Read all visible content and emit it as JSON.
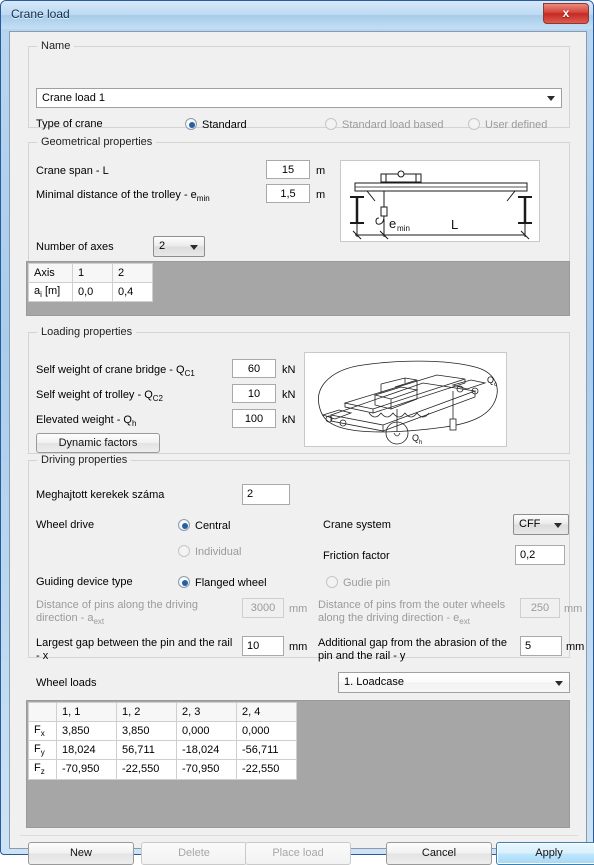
{
  "window": {
    "title": "Crane load",
    "close_label": "x"
  },
  "name_group": {
    "legend": "Name",
    "value": "Crane load 1",
    "type_label": "Type of crane",
    "options": [
      {
        "label": "Standard",
        "checked": true
      },
      {
        "label": "Standard load based",
        "checked": false
      },
      {
        "label": "User defined",
        "checked": false
      }
    ]
  },
  "geometry": {
    "legend": "Geometrical properties",
    "span_label": "Crane span - L",
    "span_value": "15",
    "span_unit": "m",
    "trolley_label": "Minimal distance of the trolley - e",
    "trolley_label_sub": "min",
    "trolley_value": "1,5",
    "trolley_unit": "m",
    "axes_label": "Number of axes",
    "axes_value": "2",
    "diagram_labels": {
      "e": "e",
      "e_sub": "min",
      "L": "L"
    },
    "table": {
      "headers": [
        "Axis",
        "1",
        "2"
      ],
      "rows": [
        {
          "label": "a",
          "label_sub": "i",
          "label_unit": " [m]",
          "cells": [
            "0,0",
            "0,4"
          ]
        }
      ]
    }
  },
  "loading": {
    "legend": "Loading properties",
    "rows": [
      {
        "label": "Self weight of crane bridge - Q",
        "sub": "C1",
        "value": "60",
        "unit": "kN"
      },
      {
        "label": "Self weight of trolley - Q",
        "sub": "C2",
        "value": "10",
        "unit": "kN"
      },
      {
        "label": "Elevated weight - Q",
        "sub": "h",
        "value": "100",
        "unit": "kN"
      }
    ],
    "dynamic_button": "Dynamic factors",
    "diagram_labels": {
      "Qc": "Q",
      "Qc_sub": "c",
      "Qh": "Q",
      "Qh_sub": "h"
    }
  },
  "driving": {
    "legend": "Driving properties",
    "driven_wheels_label": "Meghajtott kerekek száma",
    "driven_wheels_value": "2",
    "wheel_drive_label": "Wheel drive",
    "wheel_drive_options": [
      {
        "label": "Central",
        "checked": true
      },
      {
        "label": "Individual",
        "checked": false
      }
    ],
    "crane_system_label": "Crane system",
    "crane_system_value": "CFF",
    "friction_label": "Friction factor",
    "friction_value": "0,2",
    "guiding_label": "Guiding device type",
    "guiding_options": [
      {
        "label": "Flanged wheel",
        "checked": true
      },
      {
        "label": "Gudie pin",
        "checked": false
      }
    ],
    "pin_distance_label_l1": "Distance of pins along the driving",
    "pin_distance_label_l2": "direction - a",
    "pin_distance_label_sub": "ext",
    "pin_distance_value": "3000",
    "pin_distance_unit": "mm",
    "outer_pin_label_l1": "Distance of pins from the outer wheels",
    "outer_pin_label_l2": "along the driving direction - e",
    "outer_pin_label_sub": "ext",
    "outer_pin_value": "250",
    "outer_pin_unit": "mm",
    "gap_label_l1": "Largest gap between the pin and the rail",
    "gap_label_l2": "- x",
    "gap_value": "10",
    "gap_unit": "mm",
    "abrasion_label_l1": "Additional gap from the abrasion of the",
    "abrasion_label_l2": "pin and the rail - y",
    "abrasion_value": "5",
    "abrasion_unit": "mm"
  },
  "wheel_loads": {
    "label": "Wheel loads",
    "loadcase_value": "1. Loadcase",
    "table": {
      "corner": "",
      "headers": [
        "1, 1",
        "1, 2",
        "2, 3",
        "2, 4"
      ],
      "rows": [
        {
          "label": "F",
          "sub": "x",
          "cells": [
            "3,850",
            "3,850",
            "0,000",
            "0,000"
          ]
        },
        {
          "label": "F",
          "sub": "y",
          "cells": [
            "18,024",
            "56,711",
            "-18,024",
            "-56,711"
          ]
        },
        {
          "label": "F",
          "sub": "z",
          "cells": [
            "-70,950",
            "-22,550",
            "-70,950",
            "-22,550"
          ]
        }
      ]
    }
  },
  "footer": {
    "new": "New",
    "delete": "Delete",
    "place_load": "Place load",
    "cancel": "Cancel",
    "apply": "Apply"
  }
}
